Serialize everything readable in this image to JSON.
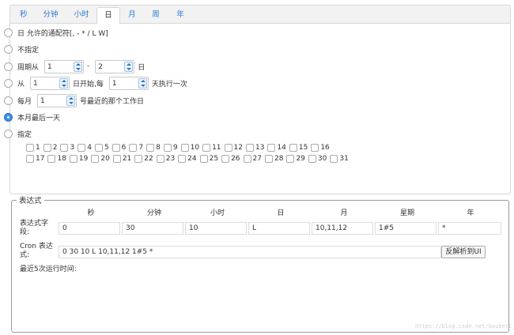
{
  "tabs": [
    "秒",
    "分钟",
    "小时",
    "日",
    "月",
    "周",
    "年"
  ],
  "active_tab": 3,
  "options": {
    "wildcard": "日 允许的通配符[, - * / L W]",
    "unspecified": "不指定",
    "period_from": "周期从",
    "period_from_value": "1",
    "period_dash": "-",
    "period_to_value": "2",
    "period_unit": "日",
    "start_from": "从",
    "start_value": "1",
    "start_mid": "日开始,每",
    "every_value": "1",
    "start_end": "天执行一次",
    "monthly": "每月",
    "monthly_value": "1",
    "monthly_end": "号最近的那个工作日",
    "last_day": "本月最后一天",
    "specify": "指定"
  },
  "days_row1": [
    "1",
    "2",
    "3",
    "4",
    "5",
    "6",
    "7",
    "8",
    "9",
    "10",
    "11",
    "12",
    "13",
    "14",
    "15",
    "16"
  ],
  "days_row2": [
    "17",
    "18",
    "19",
    "20",
    "21",
    "22",
    "23",
    "24",
    "25",
    "26",
    "27",
    "28",
    "29",
    "30",
    "31"
  ],
  "expression": {
    "legend": "表达式",
    "headers": [
      "秒",
      "分钟",
      "小时",
      "日",
      "月",
      "星期",
      "年"
    ],
    "field_label": "表达式字段:",
    "values": [
      "0",
      "30",
      "10",
      "L",
      "10,11,12",
      "1#5",
      "*"
    ],
    "cron_label": "Cron 表达式:",
    "cron_value": "0 30 10 L 10,11,12 1#5 *",
    "parse_button": "反解析到UI",
    "recent_label": "最近5次运行时间:"
  },
  "watermark": "https://blog.csdn.net/boubert_w"
}
